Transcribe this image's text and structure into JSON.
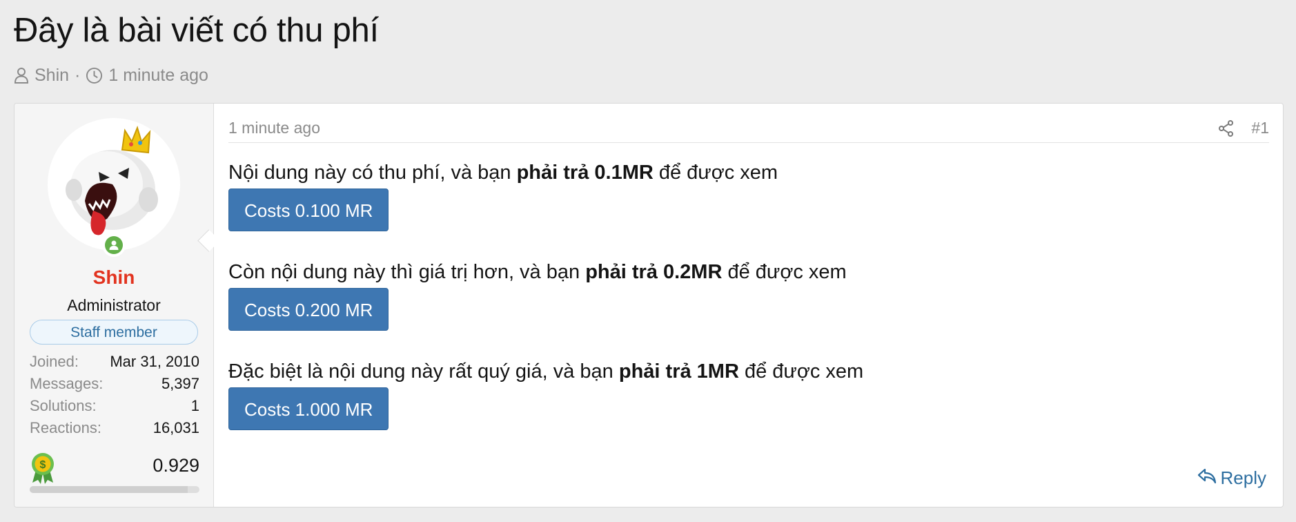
{
  "thread": {
    "title": "Đây là bài viết có thu phí",
    "author": "Shin",
    "meta_separator": "·",
    "time": "1 minute ago"
  },
  "post": {
    "time": "1 minute ago",
    "number": "#1",
    "reply_label": "Reply",
    "blocks": [
      {
        "pre": "Nội dung này có thu phí, và bạn ",
        "bold": "phải trả 0.1MR",
        "post": " để được xem",
        "button": "Costs 0.100 MR"
      },
      {
        "pre": "Còn nội dung này thì giá trị hơn, và bạn ",
        "bold": "phải trả 0.2MR",
        "post": " để được xem",
        "button": "Costs 0.200 MR"
      },
      {
        "pre": "Đặc biệt là nội dung này rất quý giá, và bạn ",
        "bold": "phải trả 1MR",
        "post": " để được xem",
        "button": "Costs 1.000 MR"
      }
    ]
  },
  "user": {
    "name": "Shin",
    "title": "Administrator",
    "badge": "Staff member",
    "stats": [
      {
        "label": "Joined:",
        "value": "Mar 31, 2010"
      },
      {
        "label": "Messages:",
        "value": "5,397"
      },
      {
        "label": "Solutions:",
        "value": "1"
      },
      {
        "label": "Reactions:",
        "value": "16,031"
      }
    ],
    "credits": "0.929",
    "credits_fraction": 0.929,
    "name_color": "#e2331f"
  },
  "icons": {
    "author": "user-icon",
    "time": "clock-icon",
    "share": "share-icon",
    "reply": "reply-icon",
    "online": "online-status-icon",
    "credits": "money-badge-icon"
  },
  "colors": {
    "accent": "#3e77b2",
    "link": "#2d6ea0",
    "online": "#63b04a"
  }
}
